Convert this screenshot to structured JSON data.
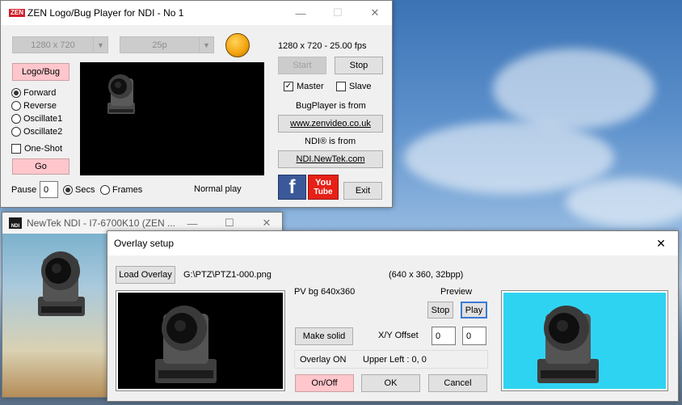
{
  "main_window": {
    "logo": "ZEN",
    "title": "ZEN Logo/Bug Player for NDI - No 1",
    "resolution_value": "1280 x 720",
    "framerate_value": "25p",
    "status_text": "1280 x 720 - 25.00 fps",
    "start_label": "Start",
    "stop_label": "Stop",
    "logo_bug_label": "Logo/Bug",
    "mode_options": [
      "Forward",
      "Reverse",
      "Oscillate1",
      "Oscillate2"
    ],
    "mode_selected": "Forward",
    "oneshot_label": "One-Shot",
    "go_label": "Go",
    "pause_label": "Pause",
    "pause_value": "0",
    "secs_label": "Secs",
    "frames_label": "Frames",
    "master_label": "Master",
    "slave_label": "Slave",
    "bugplayer_from": "BugPlayer is from",
    "zenvideo_link": "www.zenvideo.co.uk",
    "ndi_from": "NDI® is from",
    "newtek_link": "NDI.NewTek.com",
    "facebook_glyph": "f",
    "youtube_you": "You",
    "youtube_tube": "Tube",
    "normal_play": "Normal play",
    "exit_label": "Exit"
  },
  "ndi_window": {
    "icon_text": "NDI",
    "title": "NewTek NDI - I7-6700K10 (ZEN ..."
  },
  "overlay_dialog": {
    "title": "Overlay setup",
    "load_overlay_label": "Load Overlay",
    "file_path": "G:\\PTZ\\PTZ1-000.png",
    "file_info": "(640 x 360, 32bpp)",
    "pv_bg": "PV bg 640x360",
    "preview_label": "Preview",
    "stop_label": "Stop",
    "play_label": "Play",
    "make_solid_label": "Make solid",
    "xy_offset_label": "X/Y Offset",
    "x_value": "0",
    "y_value": "0",
    "overlay_status": "Overlay ON",
    "upper_left": "Upper Left : 0, 0",
    "onoff_label": "On/Off",
    "ok_label": "OK",
    "cancel_label": "Cancel"
  },
  "colors": {
    "accent_pink": "#ffc6cc",
    "preview_cyan": "#2fd3f2",
    "status_orange": "#f3a10c",
    "facebook_blue": "#3b5998",
    "youtube_red": "#e62117"
  }
}
